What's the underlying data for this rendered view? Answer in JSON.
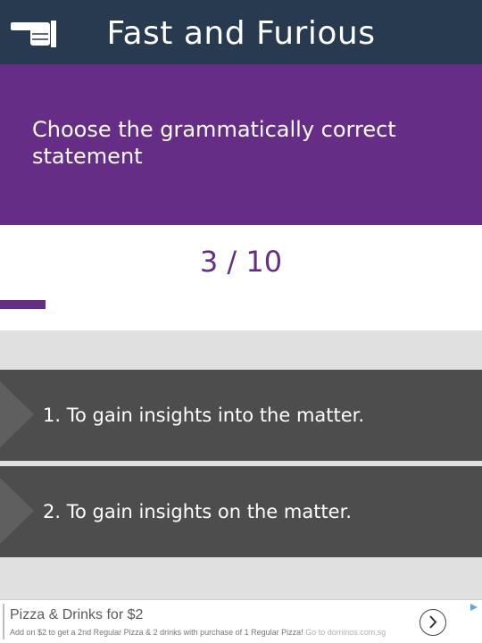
{
  "header": {
    "title": "Fast and Furious",
    "back_icon": "pointing-hand-left-icon"
  },
  "question": {
    "prompt": "Choose the grammatically correct statement"
  },
  "progress": {
    "counter_text": "3 / 10",
    "current": 3,
    "total": 10,
    "fill_fraction": 0.3
  },
  "options": [
    {
      "label": "1.  To gain insights into the matter."
    },
    {
      "label": "2.  To gain insights on the matter."
    }
  ],
  "ad": {
    "title": "Pizza & Drinks for $2",
    "description": "Add on $2 to get a 2nd Regular Pizza & 2 drinks with purchase of 1 Regular Pizza!",
    "source": "Go to dominos.com.sg",
    "arrow_icon": "chevron-right-circle-icon",
    "corner_icon": "ad-choices-icon"
  },
  "colors": {
    "header_bg": "#283a4f",
    "accent_purple": "#662d86",
    "option_bg": "#4d4d4d",
    "page_bg": "#e0e0e0"
  }
}
